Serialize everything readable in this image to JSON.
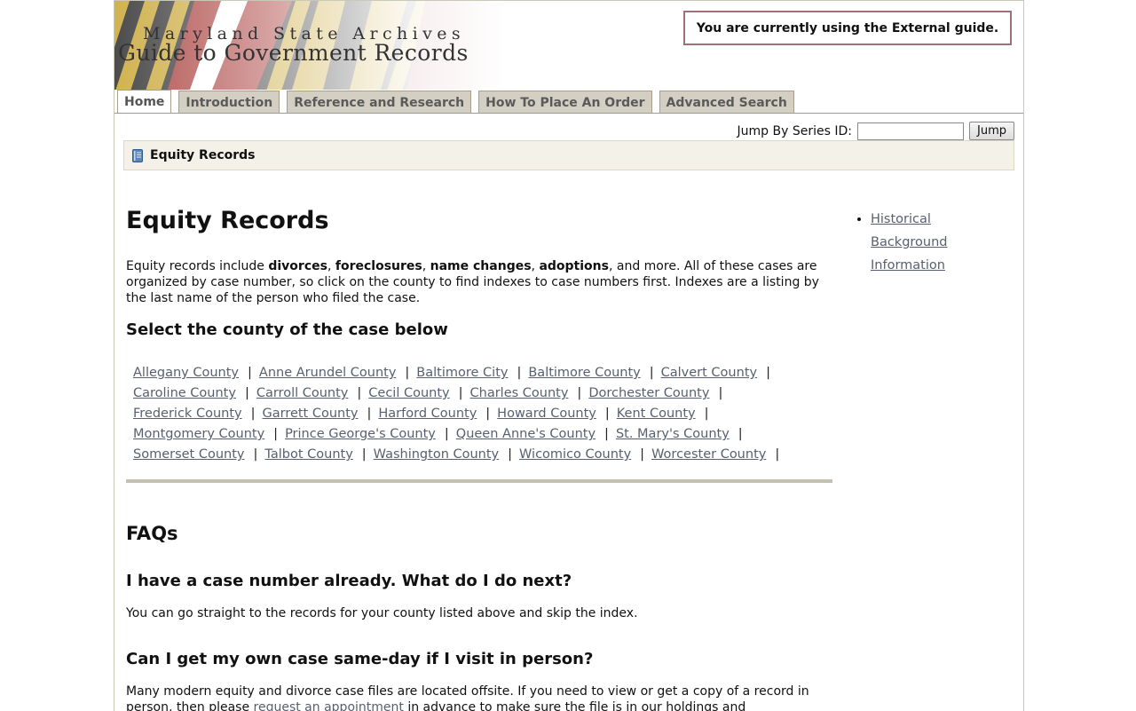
{
  "header": {
    "kicker": "Maryland State Archives",
    "title": "Guide to Government Records",
    "guide_notice": "You are currently using the External guide."
  },
  "tabs": [
    {
      "label": "Home",
      "active": true
    },
    {
      "label": "Introduction",
      "active": false
    },
    {
      "label": "Reference and Research",
      "active": false
    },
    {
      "label": "How To Place An Order",
      "active": false
    },
    {
      "label": "Advanced Search",
      "active": false
    }
  ],
  "jump": {
    "label": "Jump By Series ID:",
    "input_value": "",
    "button_label": "Jump"
  },
  "breadcrumb": {
    "icon": "book-icon",
    "label": "Equity Records"
  },
  "main": {
    "title": "Equity Records",
    "intro_parts": [
      {
        "text": "Equity records include ",
        "bold": false
      },
      {
        "text": "divorces",
        "bold": true
      },
      {
        "text": ", ",
        "bold": false
      },
      {
        "text": "foreclosures",
        "bold": true
      },
      {
        "text": ", ",
        "bold": false
      },
      {
        "text": "name changes",
        "bold": true
      },
      {
        "text": ", ",
        "bold": false
      },
      {
        "text": "adoptions",
        "bold": true
      },
      {
        "text": ", and more. All of these cases are organized by case number, so click on the county to find indexes to case numbers first. Indexes are a listing by the last name of the person who filed the case.",
        "bold": false
      }
    ],
    "select_heading": "Select the county of the case below",
    "county_rows": [
      [
        "Allegany County",
        "Anne Arundel County",
        "Baltimore City",
        "Baltimore County",
        "Calvert County"
      ],
      [
        "Caroline County",
        "Carroll County",
        "Cecil County",
        "Charles County",
        "Dorchester County"
      ],
      [
        "Frederick County",
        "Garrett County",
        "Harford County",
        "Howard County",
        "Kent County"
      ],
      [
        "Montgomery County",
        "Prince George's County",
        "Queen Anne's County",
        "St. Mary's County"
      ],
      [
        "Somerset County",
        "Talbot County",
        "Washington County",
        "Wicomico County",
        "Worcester County"
      ]
    ],
    "faq_heading": "FAQs",
    "faq": [
      {
        "question": "I have a case number already. What do I do next?",
        "answer": "You can go straight to the records for your county listed above and skip the index."
      },
      {
        "question": "Can I get my own case same-day if I visit in person?",
        "answer_before_link": "Many modern equity and divorce case files are located offsite. If you need to view or get a copy of a  record in person, then please ",
        "answer_link": "request an appointment",
        "answer_after_link": " in advance to make sure the file is in our holdings and"
      }
    ]
  },
  "sidebar": {
    "link": "Historical Background Information"
  },
  "colors": {
    "link": "#586070",
    "tab_bg": "#d4cfc3",
    "crumb_bg": "#f4f1e8",
    "notice_border": "#a0707a"
  }
}
